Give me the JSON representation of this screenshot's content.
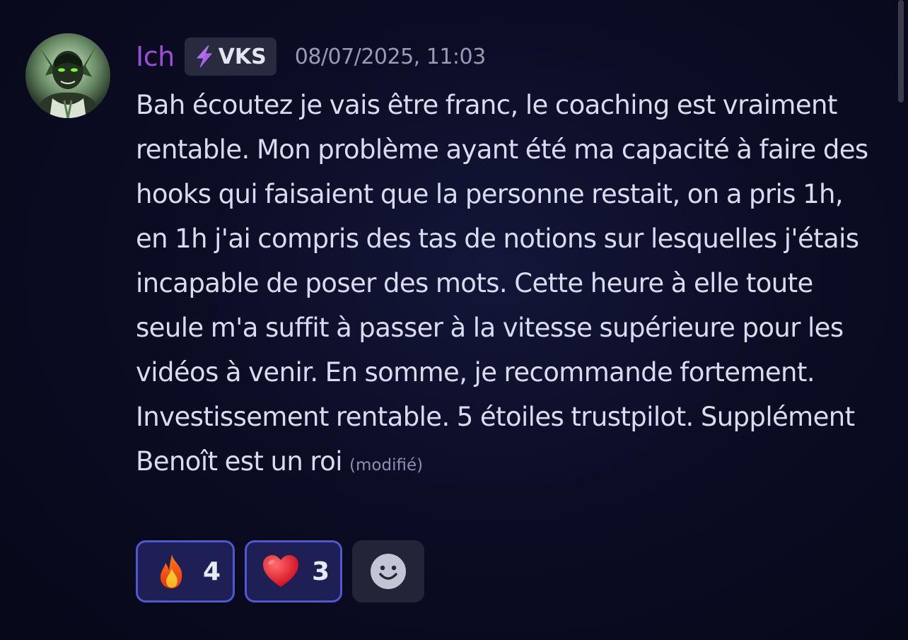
{
  "message": {
    "author": "Ich",
    "tag_icon": "lightning-bolt-icon",
    "tag_text": "VKS",
    "timestamp": "08/07/2025, 11:03",
    "text": "Bah écoutez je vais être franc, le coaching est vraiment rentable. Mon problème ayant été ma capacité à faire des hooks qui faisaient que la personne restait, on a pris 1h, en 1h j'ai compris des tas de notions sur lesquelles j'étais incapable de poser des mots. Cette heure à elle toute seule m'a suffit à passer à la vitesse supérieure pour les vidéos à venir. En somme, je recommande fortement. Investissement rentable. 5 étoiles trustpilot. Supplément Benoît est un roi",
    "edited_label": "(modifié)"
  },
  "reactions": [
    {
      "emoji": "fire",
      "count": "4"
    },
    {
      "emoji": "red-heart",
      "count": "3"
    }
  ],
  "add_reaction_icon": "smiley-add-reaction-icon",
  "colors": {
    "username": "#9a4fd6",
    "reaction_border": "#5058d0",
    "reaction_bg": "#1d1f55",
    "tag_bg": "#282a3d"
  }
}
